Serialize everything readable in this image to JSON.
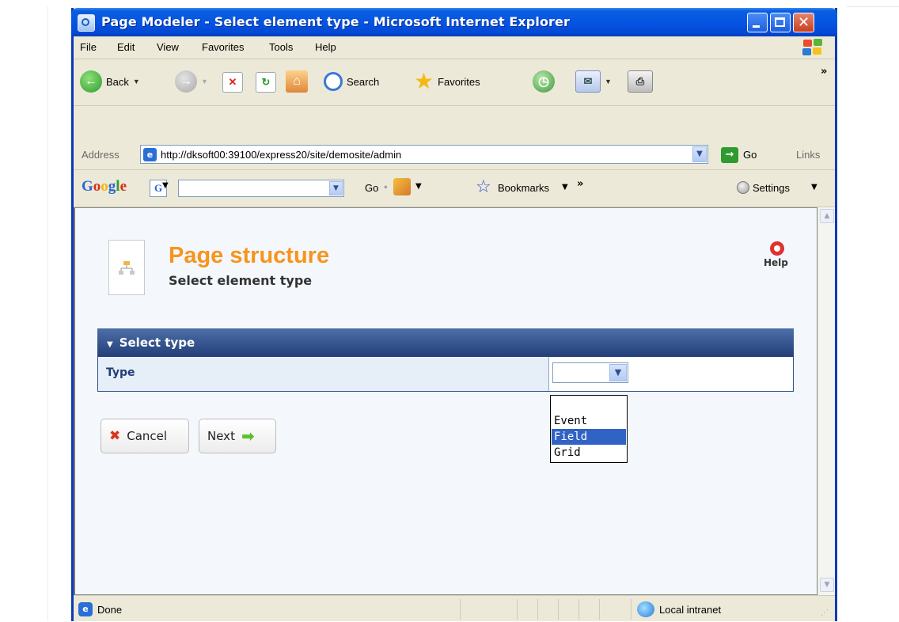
{
  "window": {
    "title": "Page Modeler - Select element type - Microsoft Internet Explorer",
    "close_glyph": "✕"
  },
  "menu": [
    "File",
    "Edit",
    "View",
    "Favorites",
    "Tools",
    "Help"
  ],
  "toolbar": {
    "back_label": "Back",
    "search_label": "Search",
    "favorites_label": "Favorites",
    "overflow": "»"
  },
  "address": {
    "label": "Address",
    "url": "http://dksoft00:39100/express20/site/demosite/admin",
    "go_label": "Go",
    "links_label": "Links"
  },
  "google_bar": {
    "logo": "Google",
    "g_button": "G",
    "go_label": "Go",
    "bookmarks_label": "Bookmarks",
    "overflow": "»",
    "settings_label": "Settings"
  },
  "page": {
    "title": "Page structure",
    "subtitle": "Select element type",
    "help_label": "Help",
    "section_title": "Select type",
    "type_label": "Type",
    "type_value": "",
    "type_options": [
      "Event",
      "Field",
      "Grid"
    ],
    "type_highlighted": "Field",
    "cancel_label": "Cancel",
    "next_label": "Next"
  },
  "status": {
    "text": "Done",
    "zone": "Local intranet"
  },
  "colors": {
    "title_orange": "#f7941d",
    "section_header": "#2c4e8a",
    "selection_blue": "#3163c5"
  }
}
